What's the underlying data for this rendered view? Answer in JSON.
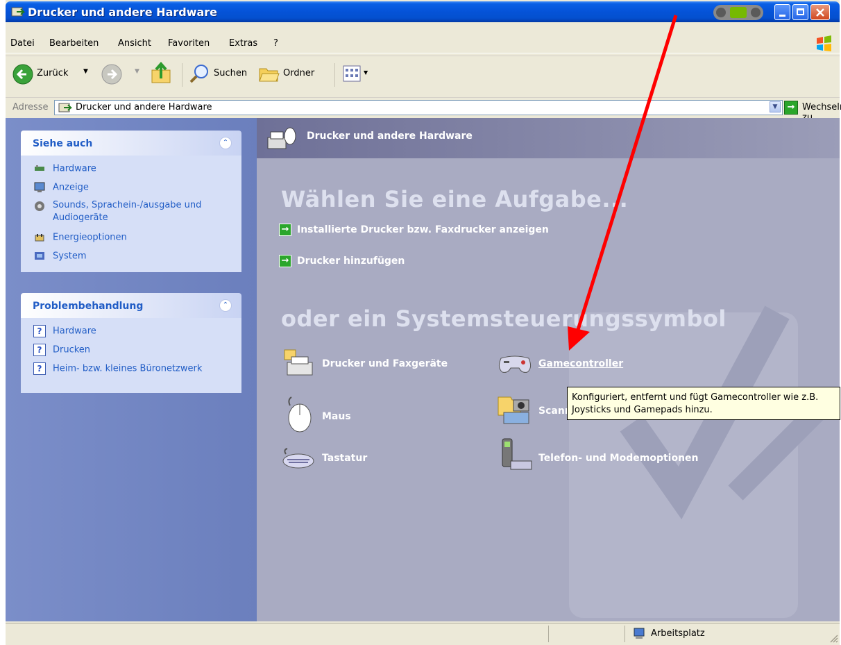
{
  "window": {
    "title": "Drucker und andere Hardware"
  },
  "menu": [
    "Datei",
    "Bearbeiten",
    "Ansicht",
    "Favoriten",
    "Extras",
    "?"
  ],
  "toolbar": {
    "back": "Zurück",
    "search": "Suchen",
    "folders": "Ordner"
  },
  "address": {
    "label": "Adresse",
    "value": "Drucker und andere Hardware",
    "go": "Wechseln zu"
  },
  "sidebar": {
    "see_also": {
      "title": "Siehe auch",
      "items": [
        "Hardware",
        "Anzeige",
        "Sounds, Sprachein-/ausgabe und",
        "Audiogeräte",
        "Energieoptionen",
        "System"
      ]
    },
    "troubleshoot": {
      "title": "Problembehandlung",
      "items": [
        "Hardware",
        "Drucken",
        "Heim- bzw. kleines Büronetzwerk"
      ]
    }
  },
  "main": {
    "header": "Drucker und andere Hardware",
    "pick_task": "Wählen Sie eine Aufgabe...",
    "tasks": [
      "Installierte Drucker bzw. Faxdrucker anzeigen",
      "Drucker hinzufügen"
    ],
    "pick_icon": "oder ein Systemsteuerungssymbol",
    "icons": [
      "Drucker und Faxgeräte",
      "Gamecontroller",
      "Maus",
      "Scanner und Kameras",
      "Tastatur",
      "Telefon- und Modemoptionen"
    ]
  },
  "tooltip": {
    "line1": "Konfiguriert, entfernt und fügt Gamecontroller wie z.B.",
    "line2": "Joysticks und Gamepads hinzu."
  },
  "status": {
    "zone": "Arbeitsplatz"
  },
  "colors": {
    "annotation_arrow": "#ff0000"
  }
}
